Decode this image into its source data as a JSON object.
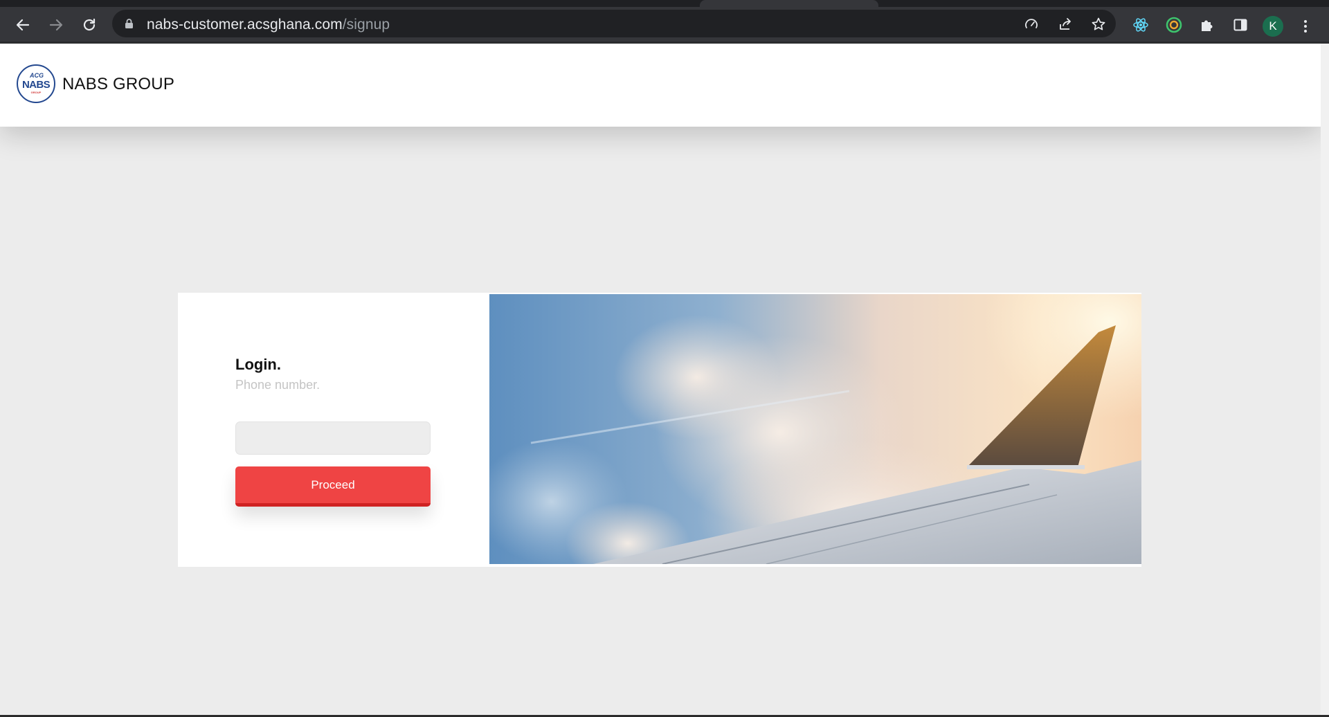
{
  "browser": {
    "url_host": "nabs-customer.acsghana.com",
    "url_path": "/signup",
    "profile_initial": "K",
    "icons": {
      "back": "back-arrow-icon",
      "forward": "forward-arrow-icon",
      "reload": "reload-icon",
      "lock": "lock-icon",
      "performance": "speedometer-icon",
      "share": "share-icon",
      "bookmark": "star-icon",
      "react_ext": "react-atom-icon",
      "ext2": "target-ring-icon",
      "extensions": "puzzle-icon",
      "side_panel": "side-panel-icon",
      "menu": "kebab-menu-icon"
    }
  },
  "header": {
    "logo_top": "ACG",
    "logo_main": "NABS",
    "logo_sub": "GROUP",
    "brand_name": "NABS GROUP"
  },
  "login": {
    "title": "Login.",
    "subtitle": "Phone number.",
    "phone_value": "",
    "proceed_label": "Proceed"
  },
  "colors": {
    "accent_red": "#ef4444",
    "logo_blue": "#23488f",
    "page_background": "#ececec"
  }
}
